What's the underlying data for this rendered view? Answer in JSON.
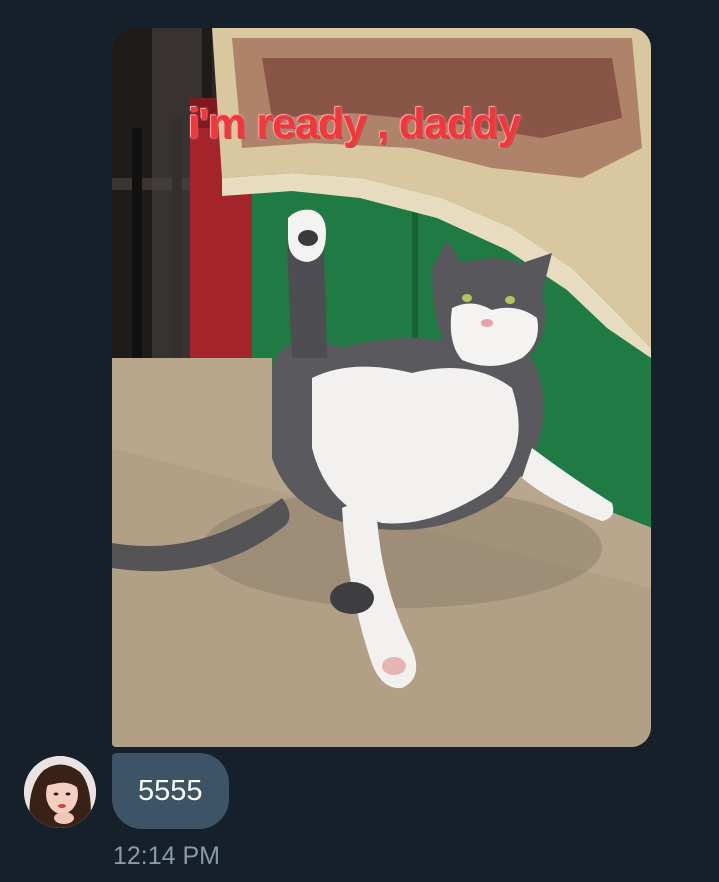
{
  "conversation": {
    "image_message": {
      "caption": "i'm ready , daddy",
      "alt": "cat-meme-photo"
    },
    "text_message": {
      "text": "5555"
    },
    "timestamp": "12:14 PM",
    "sender": {
      "avatar_icon": "user-avatar"
    }
  },
  "colors": {
    "background": "#15202b",
    "bubble": "#3d5466",
    "timestamp": "#8b98a5",
    "caption": "#f0383c"
  }
}
